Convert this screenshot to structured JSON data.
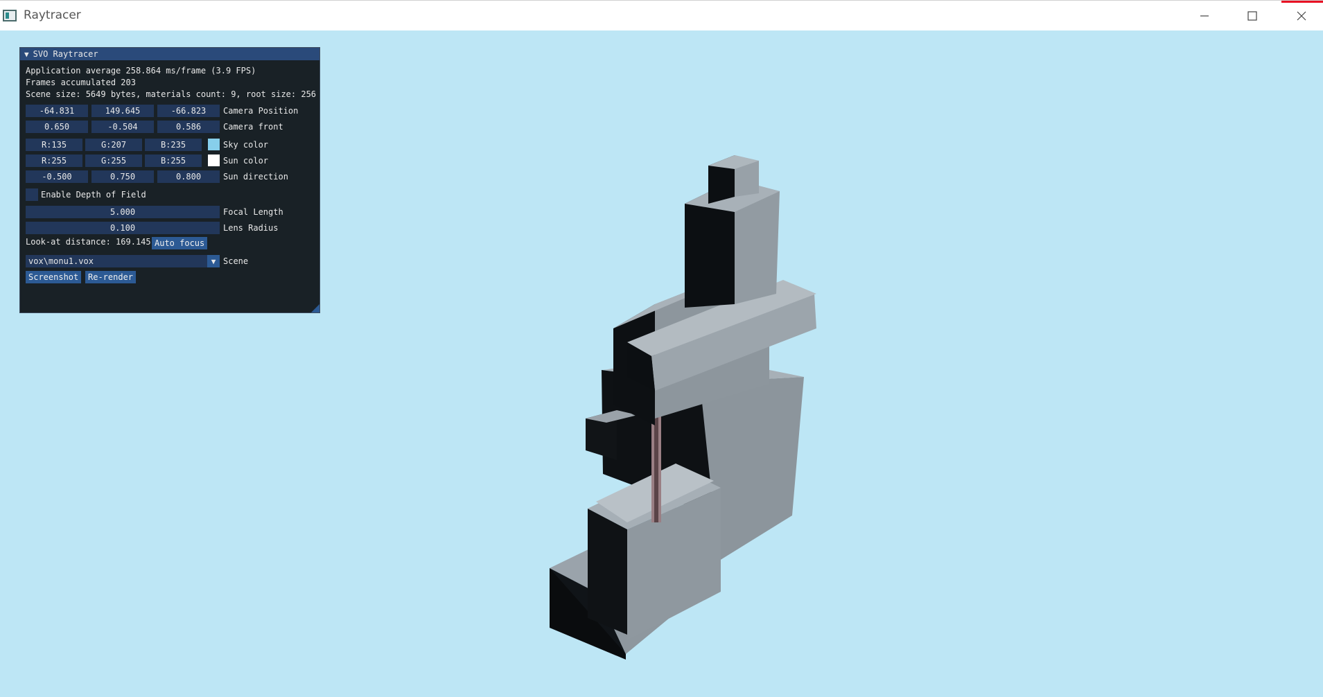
{
  "window": {
    "title": "Raytracer",
    "min_icon": "minimize-icon",
    "max_icon": "maximize-icon",
    "close_icon": "close-icon"
  },
  "panel": {
    "header": "SVO Raytracer",
    "collapse_arrow": "▼",
    "stats_line1": "Application average 258.864 ms/frame (3.9 FPS)",
    "stats_line2": "Frames accumulated 203",
    "stats_line3": "Scene size: 5649 bytes, materials count: 9, root size: 256",
    "camera_position": {
      "x": "-64.831",
      "y": "149.645",
      "z": "-66.823",
      "label": "Camera Position"
    },
    "camera_front": {
      "x": "0.650",
      "y": "-0.504",
      "z": "0.586",
      "label": "Camera front"
    },
    "sky_color": {
      "r": "R:135",
      "g": "G:207",
      "b": "B:235",
      "label": "Sky color",
      "swatch": "#87cfeb"
    },
    "sun_color": {
      "r": "R:255",
      "g": "G:255",
      "b": "B:255",
      "label": "Sun color",
      "swatch": "#ffffff"
    },
    "sun_direction": {
      "x": "-0.500",
      "y": "0.750",
      "z": "0.800",
      "label": "Sun direction"
    },
    "dof_label": "Enable Depth of Field",
    "dof_enabled": false,
    "focal_length": {
      "value": "5.000",
      "label": "Focal Length"
    },
    "lens_radius": {
      "value": "0.100",
      "label": "Lens Radius"
    },
    "lookat": "Look-at distance: 169.145",
    "auto_focus": "Auto focus",
    "scene": {
      "value": "vox\\monu1.vox",
      "label": "Scene",
      "arrow": "▼"
    },
    "screenshot": "Screenshot",
    "rerender": "Re-render"
  },
  "colors": {
    "sky": "#bde6f5",
    "panel_bg": "#0f1418",
    "field_bg": "#22375a",
    "button_bg": "#2c5a94",
    "header_bg": "#2a4a7a"
  }
}
